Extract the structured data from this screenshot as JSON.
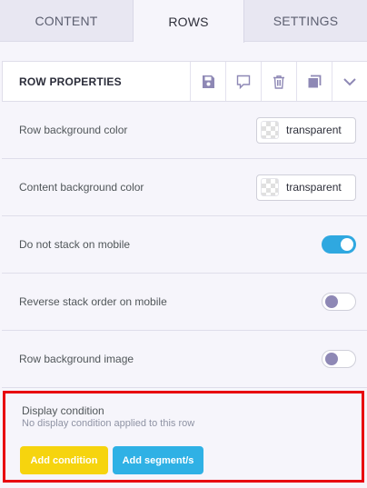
{
  "tabs": [
    {
      "label": "CONTENT",
      "active": false
    },
    {
      "label": "ROWS",
      "active": true
    },
    {
      "label": "SETTINGS",
      "active": false
    }
  ],
  "header": {
    "title": "ROW PROPERTIES",
    "icons": [
      "save-icon",
      "comment-icon",
      "trash-icon",
      "duplicate-icon",
      "chevron-down-icon"
    ]
  },
  "properties": {
    "row_bg_color": {
      "label": "Row background color",
      "value": "transparent"
    },
    "content_bg_color": {
      "label": "Content background color",
      "value": "transparent"
    },
    "no_stack": {
      "label": "Do not stack on mobile",
      "enabled": true
    },
    "reverse_stack": {
      "label": "Reverse stack order on mobile",
      "enabled": false
    },
    "row_bg_image": {
      "label": "Row background image",
      "enabled": false
    }
  },
  "display_condition": {
    "title": "Display condition",
    "subtitle": "No display condition applied to this row",
    "add_condition_label": "Add condition",
    "add_segment_label": "Add segment/s"
  },
  "colors": {
    "accent": "#2fa8e0",
    "add_condition": "#f6d40e",
    "add_segment": "#2fb1e5",
    "highlight_border": "#e8000f"
  }
}
